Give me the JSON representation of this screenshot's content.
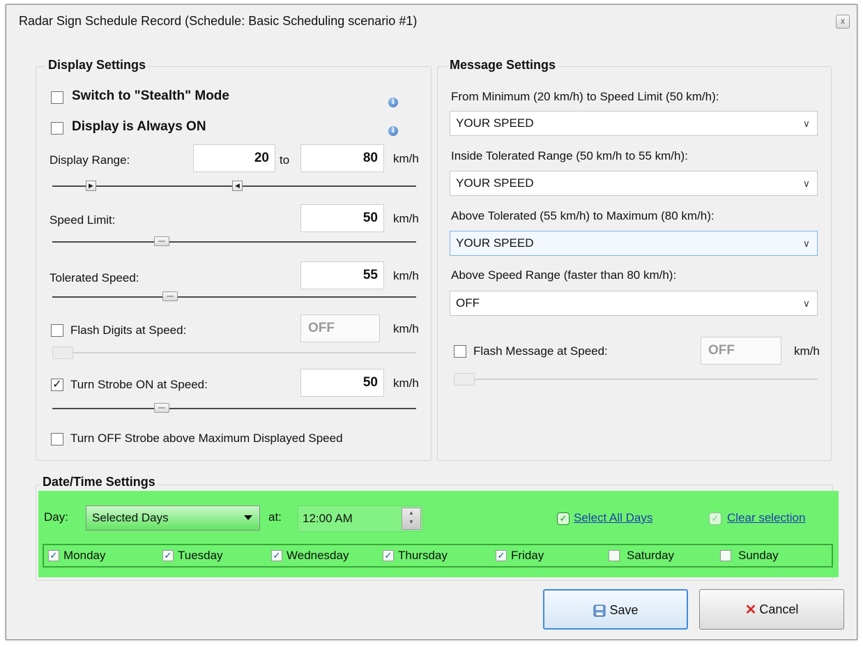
{
  "window": {
    "title": "Radar Sign Schedule Record (Schedule: Basic Scheduling scenario #1)",
    "close_glyph": "x"
  },
  "display": {
    "title": "Display Settings",
    "stealth_label": "Switch to \"Stealth\" Mode",
    "always_on_label": "Display is Always ON",
    "range_label": "Display Range:",
    "range_min": "20",
    "range_to": "to",
    "range_max": "80",
    "unit": "km/h",
    "speed_limit_label": "Speed Limit:",
    "speed_limit": "50",
    "tolerated_label": "Tolerated Speed:",
    "tolerated": "55",
    "flash_label": "Flash Digits at Speed:",
    "flash_value": "OFF",
    "strobe_label": "Turn Strobe ON at Speed:",
    "strobe_value": "50",
    "strobe_check": "✓",
    "strobe_off_label": "Turn OFF Strobe above Maximum Displayed Speed"
  },
  "message": {
    "title": "Message Settings",
    "from_min_label": "From Minimum (20 km/h) to Speed Limit (50 km/h):",
    "from_min_value": "YOUR SPEED",
    "inside_label": "Inside Tolerated Range (50 km/h to 55 km/h):",
    "inside_value": "YOUR SPEED",
    "above_tol_label": "Above Tolerated (55 km/h) to Maximum (80 km/h):",
    "above_tol_value": "YOUR SPEED",
    "above_range_label": "Above Speed Range (faster than 80 km/h):",
    "above_range_value": "OFF",
    "flash_label": "Flash Message at Speed:",
    "flash_value": "OFF",
    "unit": "km/h"
  },
  "datetime": {
    "title": "Date/Time Settings",
    "day_label": "Day:",
    "day_value": "Selected Days",
    "at_label": "at:",
    "time_value": "12:00 AM",
    "select_all": "Select All Days",
    "clear": "Clear selection",
    "check_glyph": "✓",
    "days": [
      {
        "label": "Monday",
        "mark": "✓"
      },
      {
        "label": "Tuesday",
        "mark": "✓"
      },
      {
        "label": "Wednesday",
        "mark": "✓"
      },
      {
        "label": "Thursday",
        "mark": "✓"
      },
      {
        "label": "Friday",
        "mark": "✓"
      },
      {
        "label": "Saturday",
        "mark": ""
      },
      {
        "label": "Sunday",
        "mark": ""
      }
    ]
  },
  "buttons": {
    "save": "Save",
    "cancel": "Cancel",
    "cancel_glyph": "✕"
  },
  "colors": {
    "accent_green": "#6ff26f",
    "focus_blue": "#3d8be0",
    "cancel_red": "#d9262b"
  }
}
